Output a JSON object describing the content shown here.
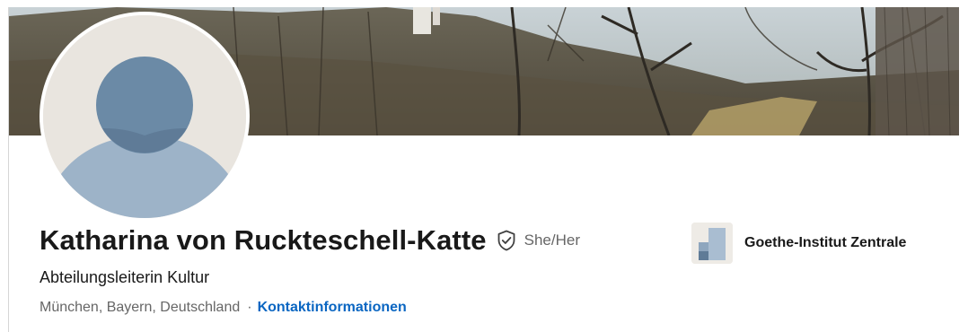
{
  "profile": {
    "name": "Katharina von Ruckteschell-Katte",
    "pronouns": "She/Her",
    "headline": "Abteilungsleiterin Kultur",
    "location": "München, Bayern, Deutschland",
    "separator": "·",
    "contact_link": "Kontaktinformationen"
  },
  "organization": {
    "name": "Goethe-Institut Zentrale",
    "logo_icon": "company-logo-icon"
  },
  "icons": {
    "verified": "verified-shield-icon",
    "avatar": "default-avatar-icon"
  },
  "colors": {
    "link": "#0a66c2",
    "text_primary": "#191919",
    "text_secondary": "#666666",
    "avatar_bg": "#e9e5df",
    "avatar_figure": "#9db3c8",
    "avatar_head": "#6b8aa6"
  }
}
